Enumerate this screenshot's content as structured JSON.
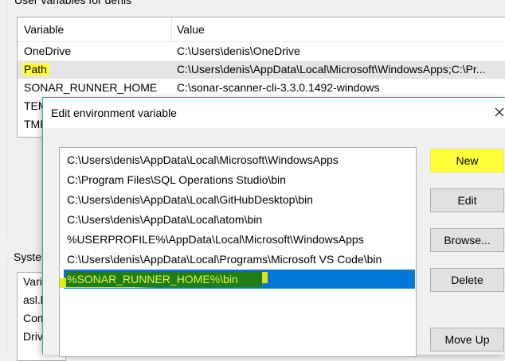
{
  "background": {
    "user_group_title": "User variables for denis",
    "user_list": {
      "headers": [
        "Variable",
        "Value"
      ],
      "rows": [
        {
          "variable": "OneDrive",
          "value": "C:\\Users\\denis\\OneDrive"
        },
        {
          "variable": "Path",
          "value": "C:\\Users\\denis\\AppData\\Local\\Microsoft\\WindowsApps;C:\\Pr..."
        },
        {
          "variable": "SONAR_RUNNER_HOME",
          "value": "C:\\sonar-scanner-cli-3.3.0.1492-windows"
        },
        {
          "variable": "TEM",
          "value": ""
        },
        {
          "variable": "TMP",
          "value": ""
        }
      ]
    },
    "system_group_title": "Syste",
    "system_list": [
      "Varia",
      "asl.l",
      "Com",
      "Driv"
    ]
  },
  "dialog": {
    "title": "Edit environment variable",
    "paths": [
      "C:\\Users\\denis\\AppData\\Local\\Microsoft\\WindowsApps",
      "C:\\Program Files\\SQL Operations Studio\\bin",
      "C:\\Users\\denis\\AppData\\Local\\GitHubDesktop\\bin",
      "C:\\Users\\denis\\AppData\\Local\\atom\\bin",
      "%USERPROFILE%\\AppData\\Local\\Microsoft\\WindowsApps",
      "C:\\Users\\denis\\AppData\\Local\\Programs\\Microsoft VS Code\\bin"
    ],
    "selected_path": "%SONAR_RUNNER_HOME%\\bin",
    "buttons": {
      "new": "New",
      "edit": "Edit",
      "browse": "Browse...",
      "delete": "Delete",
      "move_up": "Move Up"
    }
  },
  "colors": {
    "selection": "#0078d7",
    "highlight_yellow": "#ffff3a",
    "dialog_border": "#2fb07a"
  },
  "icons": {
    "close": "close-icon"
  }
}
